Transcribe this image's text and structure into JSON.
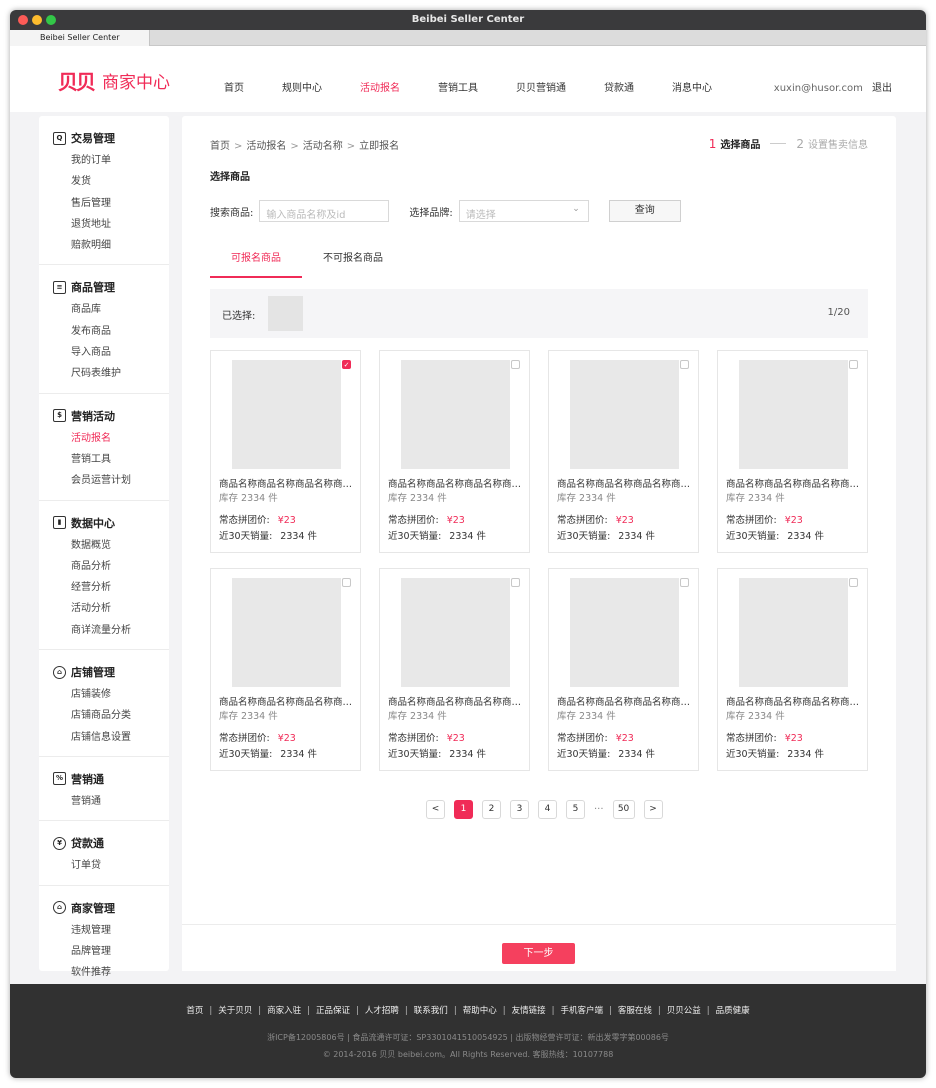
{
  "window": {
    "title": "Beibei Seller Center",
    "tab_label": "Beibei Seller Center"
  },
  "header": {
    "logo_mark": "贝贝",
    "logo_text": "商家中心",
    "nav": [
      "首页",
      "规则中心",
      "活动报名",
      "营销工具",
      "贝贝营销通",
      "贷款通",
      "消息中心"
    ],
    "nav_active": "活动报名",
    "user_email": "xuxin@husor.com",
    "logout": "退出"
  },
  "sidebar": {
    "groups": [
      {
        "title": "交易管理",
        "icon": "receipt-search-icon",
        "items": [
          "我的订单",
          "发货",
          "售后管理",
          "退货地址",
          "赔款明细"
        ]
      },
      {
        "title": "商品管理",
        "icon": "clipboard-icon",
        "items": [
          "商品库",
          "发布商品",
          "导入商品",
          "尺码表维护"
        ]
      },
      {
        "title": "营销活动",
        "icon": "money-bag-icon",
        "items": [
          "活动报名",
          "营销工具",
          "会员运营计划"
        ]
      },
      {
        "title": "数据中心",
        "icon": "bar-chart-icon",
        "items": [
          "数据概览",
          "商品分析",
          "经营分析",
          "活动分析",
          "商详流量分析"
        ]
      },
      {
        "title": "店铺管理",
        "icon": "store-icon",
        "items": [
          "店铺装修",
          "店铺商品分类",
          "店铺信息设置"
        ]
      },
      {
        "title": "营销通",
        "icon": "percent-tag-icon",
        "items": [
          "营销通"
        ]
      },
      {
        "title": "贷款通",
        "icon": "yen-coin-icon",
        "items": [
          "订单贷"
        ]
      },
      {
        "title": "商家管理",
        "icon": "shop-house-icon",
        "items": [
          "违规管理",
          "品牌管理",
          "软件推荐"
        ]
      }
    ],
    "active_item": "活动报名"
  },
  "main": {
    "breadcrumb": [
      "首页",
      "活动报名",
      "活动名称",
      "立即报名"
    ],
    "breadcrumb_sep": ">",
    "steps": [
      {
        "num": "1",
        "label": "选择商品",
        "active": true
      },
      {
        "num": "2",
        "label": "设置售卖信息",
        "active": false
      }
    ],
    "section_title": "选择商品",
    "filter": {
      "search_label": "搜索商品:",
      "search_placeholder": "输入商品名称及id",
      "brand_label": "选择品牌:",
      "brand_placeholder": "请选择",
      "query_button": "查询"
    },
    "tabs": [
      {
        "label": "可报名商品",
        "active": true
      },
      {
        "label": "不可报名商品",
        "active": false
      }
    ],
    "selected": {
      "label": "已选择:",
      "count": "1/20"
    },
    "products": [
      {
        "name": "商品名称商品名称商品名称商品名称",
        "stock": "库存 2334 件",
        "price_label": "常态拼团价:",
        "price": "¥23",
        "sales_label": "近30天销量:",
        "sales": "2334 件",
        "checked": true
      },
      {
        "name": "商品名称商品名称商品名称商品名称",
        "stock": "库存 2334 件",
        "price_label": "常态拼团价:",
        "price": "¥23",
        "sales_label": "近30天销量:",
        "sales": "2334 件",
        "checked": false
      },
      {
        "name": "商品名称商品名称商品名称商品名称",
        "stock": "库存 2334 件",
        "price_label": "常态拼团价:",
        "price": "¥23",
        "sales_label": "近30天销量:",
        "sales": "2334 件",
        "checked": false
      },
      {
        "name": "商品名称商品名称商品名称商品名称",
        "stock": "库存 2334 件",
        "price_label": "常态拼团价:",
        "price": "¥23",
        "sales_label": "近30天销量:",
        "sales": "2334 件",
        "checked": false
      },
      {
        "name": "商品名称商品名称商品名称商品名称",
        "stock": "库存 2334 件",
        "price_label": "常态拼团价:",
        "price": "¥23",
        "sales_label": "近30天销量:",
        "sales": "2334 件",
        "checked": false
      },
      {
        "name": "商品名称商品名称商品名称商品名称",
        "stock": "库存 2334 件",
        "price_label": "常态拼团价:",
        "price": "¥23",
        "sales_label": "近30天销量:",
        "sales": "2334 件",
        "checked": false
      },
      {
        "name": "商品名称商品名称商品名称商品名称",
        "stock": "库存 2334 件",
        "price_label": "常态拼团价:",
        "price": "¥23",
        "sales_label": "近30天销量:",
        "sales": "2334 件",
        "checked": false
      },
      {
        "name": "商品名称商品名称商品名称商品名称",
        "stock": "库存 2334 件",
        "price_label": "常态拼团价:",
        "price": "¥23",
        "sales_label": "近30天销量:",
        "sales": "2334 件",
        "checked": false
      }
    ],
    "pager": {
      "prev": "<",
      "pages": [
        "1",
        "2",
        "3",
        "4",
        "5"
      ],
      "dots": "···",
      "last": "50",
      "next": ">",
      "current": "1"
    },
    "next_button": "下一步"
  },
  "footer": {
    "links": [
      "首页",
      "关于贝贝",
      "商家入驻",
      "正品保证",
      "人才招聘",
      "联系我们",
      "帮助中心",
      "友情链接",
      "手机客户端",
      "客服在线",
      "贝贝公益",
      "品质健康"
    ],
    "icp": "浙ICP备12005806号 | 食品流通许可证：SP3301041510054925 | 出版物经营许可证：新出发零字第00086号",
    "copyright": "© 2014-2016 贝贝 beibei.com。All Rights Reserved. 客服热线：10107788"
  },
  "colors": {
    "accent": "#f02b57",
    "footer_bg": "#313131",
    "page_bg": "#f3f3f5"
  }
}
